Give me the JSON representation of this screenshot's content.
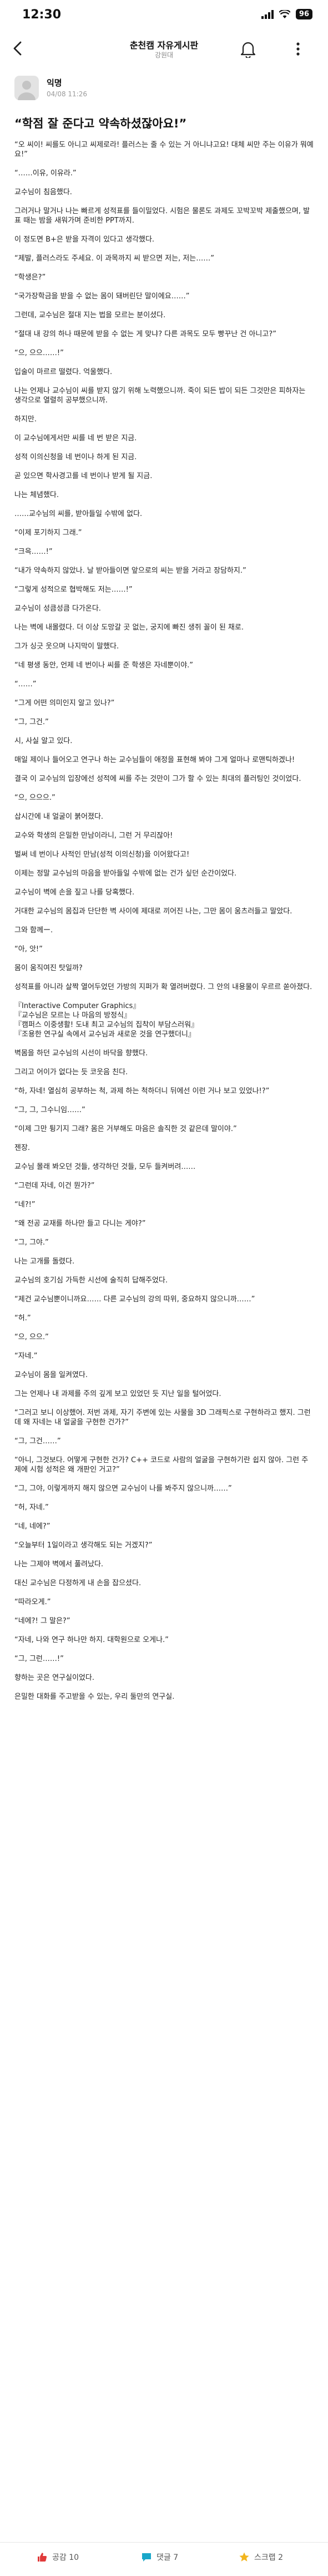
{
  "status": {
    "time": "12:30",
    "battery": "96"
  },
  "header": {
    "title": "춘천캠 자유게시판",
    "subtitle": "강원대"
  },
  "post": {
    "author": "익명",
    "date": "04/08 11:26",
    "title": "“학점 잘 준다고 약속하셨잖아요!”",
    "body": [
      "“오 씨이! 씨를도 아니고 씨제로라! 플러스는 줄 수 있는 거 아니냐고요! 대체 씨만 주는 이유가 뭐예요!”",
      "",
      "“……이유, 이유라.”",
      "",
      "교수님이 침음했다.",
      "",
      "그러거나 말거나 나는 빠르게 성적표를 들이밀었다. 시험은 물론도 과제도 꼬박꼬박 제출했으며, 발표 때는 밤을 새워가며 준비한 PPT까지.",
      "",
      "이 정도면 B+은 받을 자격이 있다고 생각했다.",
      "",
      "“제발, 플러스라도 주세요. 이 과목까지 씨 받으면 저는, 저는……”",
      "",
      "“학생은?”",
      "",
      "“국가장학금을 받을 수 없는 몸이 돼버린단 말이에요……”",
      "",
      "그런데, 교수님은 절대 지는 법을 모르는 분이셨다.",
      "",
      "“절대 내 강의 하나 때문에 받을 수 없는 게 맞냐? 다른 과목도 모두 빵꾸난 건 아니고?”",
      "",
      "“으, 으으……!”",
      "",
      "입술이 마르르 떨렸다. 억울했다.",
      "",
      "나는 언제나 교수님이 씨를 받지 않기 위해 노력했으니까. 죽이 되든 밥이 되든 그것만은 피하자는 생각으로 열렬히 공부했으니까.",
      "",
      "하지만.",
      "",
      "이 교수님에게서만 씨를 네 번 받은 지금.",
      "",
      "성적 이의신청을 네 번이나 하게 된 지금.",
      "",
      "곧 있으면 학사경고를 네 번이나 받게 될 지금.",
      "",
      "나는 체념했다.",
      "",
      "……교수님의 씨를, 받아들일 수밖에 없다.",
      "",
      "“이제 포기하지 그래.”",
      "",
      "“크윽……!”",
      "",
      "“내가 약속하지 않았나. 날 받아들이면 앞으로의 씨는 받을 거라고 장담하지.”",
      "",
      "“그렇게 성적으로 협박해도 저는……!”",
      "",
      "교수님이 성큼성큼 다가온다.",
      "",
      "나는 벽에 내몰렸다. 더 이상 도망갈 곳 없는, 궁지에 빠진 생쥐 꼴이 된 채로.",
      "",
      "그가 싱긋 웃으며 나지막이 말했다.",
      "",
      "“네 평생 동안, 언제 네 번이나 씨를 준 학생은 자네뿐이야.”",
      "",
      "“……”",
      "",
      "“그게 어떤 의미인지 알고 있나?”",
      "",
      "“그, 그건.”",
      "",
      "시, 사실 알고 있다.",
      "",
      "매일 제이나 들어오고 연구나 하는 교수님들이 애정을 표현해 봐야 그게 얼마나 로맨틱하겠나!",
      "",
      "결국 이 교수님의 입장에선 성적에 씨를 주는 것만이 그가 할 수 있는 최대의 플러팅인 것이었다.",
      "",
      "“으, 으으으.”",
      "",
      "삽시간에 내 얼굴이 붉어졌다.",
      "",
      "교수와 학생의 은밀한 만남이라니, 그런 거 무리잖아!",
      "",
      "벌써 네 번이나 사적인 만남(성적 이의신청)을 이어왔다고!",
      "",
      "이제는 정말 교수님의 마음을 받아들일 수밖에 없는 건가 싶던 순간이었다.",
      "",
      "교수님이 벽에 손을 짚고 나를 당혹했다.",
      "",
      "거대한 교수님의 몸집과 단단한 벽 사이에 제대로 끼어진 나는, 그만 몸이 움츠러들고 말았다.",
      "",
      "그와 함께ー.",
      "",
      "“아, 앗!”",
      "",
      "몸이 움직여진 탓일까?",
      "",
      "성적표를 아니라 살짝 열어두었던 가방의 지퍼가 확 열려버렸다. 그 안의 내용물이 우르르 쏟아졌다.",
      "",
      "『Interactive Computer Graphics』",
      "『교수님은 모르는 나 마음의 방정식』",
      "『캠퍼스 이중생활! 도내 최고 교수님의 집착이 부담스러워』",
      "『조용한 연구실 속에서 교수님과 새로운 것을 연구했더니』",
      "",
      "벽몸을 하던 교수님의 시선이 바닥을 향했다.",
      "",
      "그리고 어이가 없다는 듯 코웃음 친다.",
      "",
      "“하, 자네! 열심히 공부하는 척, 과제 하는 척하더니 뒤에선 이런 거나 보고 있었나!?”",
      "",
      "“그, 그, 그수니임……”",
      "",
      "“이제 그만 튕기지 그래? 몸은 거부해도 마음은 솔직한 것 같은데 말이야.”",
      "",
      "젠장.",
      "",
      "교수님 몰래 봐오던 것들, 생각하던 것들, 모두 들켜버려……",
      "",
      "“그런데 자네, 이건 뭔가?”",
      "",
      "“네?!”",
      "",
      "“왜 전공 교재를 하나만 들고 다니는 게야?”",
      "",
      "“그, 그야.”",
      "",
      "나는 고개를 돌렸다.",
      "",
      "교수님의 호기심 가득한 시선에 술직히 답해주었다.",
      "",
      "“제건 교수님뿐이니까요…… 다른 교수님의 강의 따위, 중요하지 않으니까……”",
      "",
      "“허.”",
      "",
      "“으, 으으.”",
      "",
      "“자네.”",
      "",
      "교수님이 몸을 일켜였다.",
      "",
      "그는 언제나 내 과제를 주의 깊게 보고 있었던 듯 지난 일을 털어었다.",
      "",
      "“그러고 보니 이상했어. 저번 과제, 자기 주변에 있는 사물을 3D 그래픽스로 구현하라고 했지. 그런데 왜 자네는 내 얼굴을 구현한 건가?”",
      "",
      "“그, 그건……”",
      "",
      "“아니, 그것보다. 어떻게 구현한 건가? C++ 코드로 사람의 얼굴을 구현하기란 쉽지 않아. 그런 주제에 시험 성적은 왜 개판인 거고?”",
      "",
      "“그, 그야, 이렇게까지 해지 않으면 교수님이 나를 봐주지 않으니까……”",
      "",
      "“허, 자네.”",
      "",
      "“네, 네에?”",
      "",
      "“오늘부터 1일이라고 생각해도 되는 거겠지?”",
      "",
      "나는 그제야 벽에서 풀려났다.",
      "",
      "대신 교수님은 다정하게 내 손을 잡으셨다.",
      "",
      "“따라오게.”",
      "",
      "“네에?! 그 말은?”",
      "",
      "“자네, 나와 연구 하나만 하지. 대학원으로 오게나.”",
      "",
      "“그, 그런……!”",
      "",
      "향하는 곳은 연구실이었다.",
      "",
      "은밀한 대화를 주고받을 수 있는, 우리 둘만의 연구실."
    ]
  },
  "footer": {
    "like": "공감 10",
    "comment": "댓글 7",
    "scrap": "스크랩 2"
  },
  "colors": {
    "accent": "#e03a3a",
    "text": "#222222",
    "muted": "#9a9a9a"
  }
}
